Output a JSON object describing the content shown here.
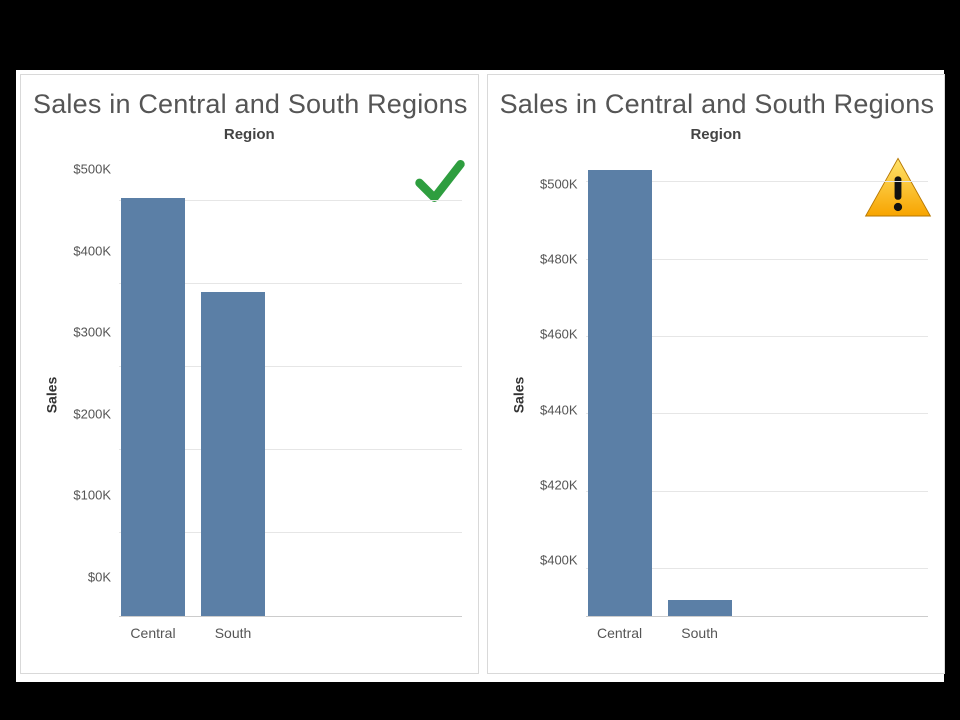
{
  "colors": {
    "bar": "#5b7fa6"
  },
  "panels": [
    {
      "title": "Sales in Central and South Regions",
      "subhead": "Region",
      "yaxis_title": "Sales",
      "status": "good",
      "y_ticks": [
        "$500K",
        "$400K",
        "$300K",
        "$200K",
        "$100K",
        "$0K"
      ],
      "x_labels": [
        "Central",
        "South"
      ]
    },
    {
      "title": "Sales in Central and South Regions",
      "subhead": "Region",
      "yaxis_title": "Sales",
      "status": "warning",
      "y_ticks": [
        "$500K",
        "$480K",
        "$460K",
        "$440K",
        "$420K",
        "$400K"
      ],
      "x_labels": [
        "Central",
        "South"
      ]
    }
  ],
  "chart_data": [
    {
      "type": "bar",
      "title": "Sales in Central and South Regions",
      "subtitle": "Region",
      "ylabel": "Sales",
      "categories": [
        "Central",
        "South"
      ],
      "values": [
        503000,
        390000
      ],
      "ylim": [
        0,
        550000
      ],
      "y_tick_values": [
        0,
        100000,
        200000,
        300000,
        400000,
        500000
      ],
      "annotation": "good-baseline"
    },
    {
      "type": "bar",
      "title": "Sales in Central and South Regions",
      "subtitle": "Region",
      "ylabel": "Sales",
      "categories": [
        "Central",
        "South"
      ],
      "values": [
        503000,
        392000
      ],
      "ylim": [
        388000,
        506000
      ],
      "y_tick_values": [
        400000,
        420000,
        440000,
        460000,
        480000,
        500000
      ],
      "annotation": "truncated-baseline"
    }
  ]
}
